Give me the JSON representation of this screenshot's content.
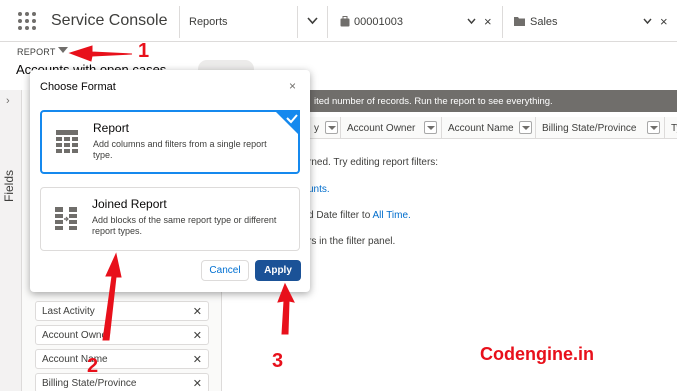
{
  "top_nav": {
    "app_name": "Service Console",
    "tabs": [
      {
        "label": "Reports",
        "icon": "chevron-down-icon"
      },
      {
        "label": "00001003",
        "icon": "case-icon"
      },
      {
        "label": "Sales",
        "icon": "folder-icon"
      }
    ],
    "close_glyph": "×"
  },
  "report_header": {
    "type_label": "REPORT",
    "title": "Accounts with open cases"
  },
  "sidebar": {
    "panel_label": "Fields",
    "columns": [
      {
        "label": "Last Activity"
      },
      {
        "label": "Account Owner"
      },
      {
        "label": "Account Name"
      },
      {
        "label": "Billing State/Province"
      }
    ]
  },
  "preview": {
    "banner": "ited number of records. Run the report to see everything.",
    "columns": [
      "y",
      "Account Owner",
      "Account Name",
      "Billing State/Province",
      "Ty"
    ],
    "message_1": "rned. Try editing report filters:",
    "message_2_link": "unts.",
    "message_3_prefix": "d Date filter to ",
    "message_3_link": "All Time.",
    "message_4": "rs in the filter panel."
  },
  "modal": {
    "title": "Choose Format",
    "close_glyph": "×",
    "options": [
      {
        "title": "Report",
        "description": "Add columns and filters from a single report type.",
        "icon": "report-table-icon",
        "selected": true
      },
      {
        "title": "Joined Report",
        "description": "Add blocks of the same report type or different report types.",
        "icon": "joined-report-icon",
        "selected": false
      }
    ],
    "cancel_label": "Cancel",
    "apply_label": "Apply"
  },
  "annotations": {
    "step_1": "1",
    "step_2": "2",
    "step_3": "3",
    "watermark": "Codengine.in",
    "color": "#e8101b"
  },
  "colors": {
    "brand_blue": "#1b5297",
    "selection_blue": "#1589ee",
    "link_blue": "#006dcc",
    "banner_gray": "#706e6b"
  }
}
